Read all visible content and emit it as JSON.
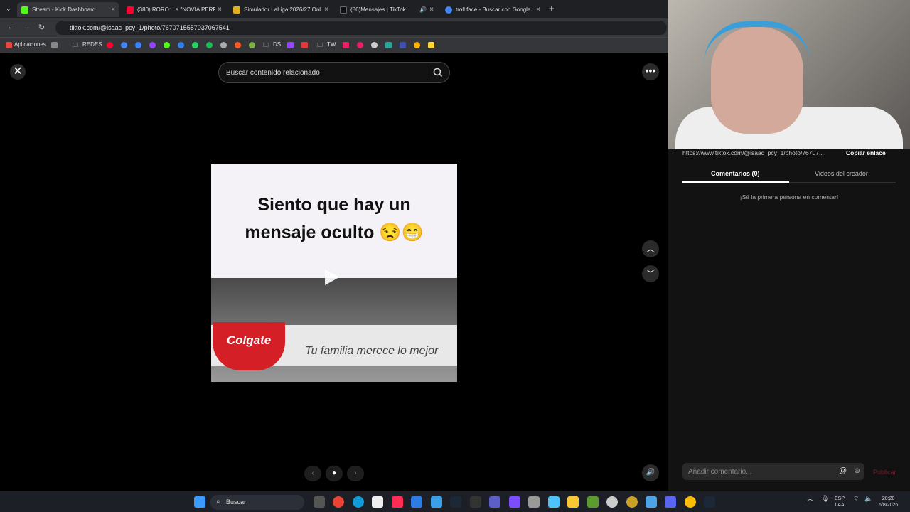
{
  "browser": {
    "tabs": [
      {
        "label": "Stream - Kick Dashboard",
        "color": "#53fc18"
      },
      {
        "label": "(380) RORO: La \"NOVIA PERFEC",
        "color": "#ff0033"
      },
      {
        "label": "Simulador LaLiga 2026/27 Onli",
        "color": "#e0b020"
      },
      {
        "label": "(86)Mensajes | TikTok",
        "color": "#111111"
      },
      {
        "label": "troll face - Buscar con Google",
        "color": "#4285f4"
      }
    ],
    "url": "tiktok.com/@isaac_pcy_1/photo/7670715557037067541",
    "bookmarks": {
      "apps": "Aplicaciones",
      "redes": "REDES",
      "ds": "DS",
      "tw": "TW"
    }
  },
  "viewer": {
    "search_placeholder": "Buscar contenido relacionado",
    "post": {
      "caption_line1": "Siento que hay un",
      "caption_line2": "mensaje oculto 😒😁",
      "brand": "Colgate",
      "slogan": "Tu familia merece lo mejor"
    }
  },
  "sidebar": {
    "link": "https://www.tiktok.com/@isaac_pcy_1/photo/76707...",
    "copy_label": "Copiar enlace",
    "tabs": [
      "Comentarios (0)",
      "Videos del creador"
    ],
    "empty_text": "¡Sé la primera persona en comentar!",
    "comment_placeholder": "Añadir comentario...",
    "publish_label": "Publicar"
  },
  "taskbar": {
    "search_label": "Buscar",
    "lang": "ESP",
    "region": "LAA",
    "time": "20:20",
    "date": "6/8/2026"
  }
}
